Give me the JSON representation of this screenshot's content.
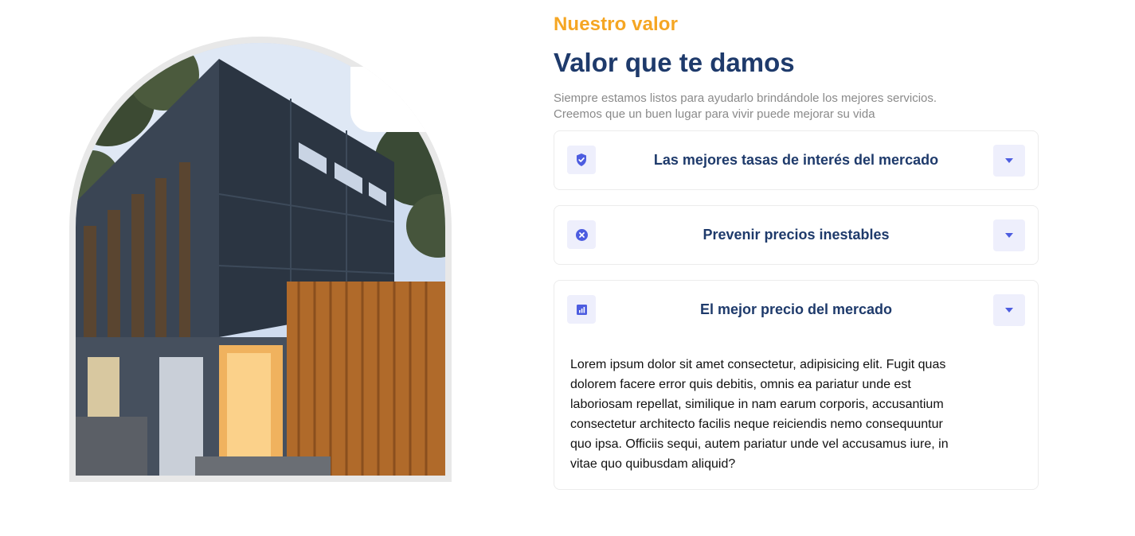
{
  "section": {
    "eyebrow": "Nuestro valor",
    "title": "Valor que te damos",
    "subtitle_lines": [
      "Siempre estamos listos para ayudarlo brindándole los mejores servicios.",
      "Creemos que un buen lugar para vivir puede mejorar su vida"
    ]
  },
  "image": {
    "description_icon": "house-photo"
  },
  "accordion": [
    {
      "icon": "shield-check-icon",
      "title": "Las mejores tasas de interés del mercado",
      "expanded": false
    },
    {
      "icon": "cancel-circle-icon",
      "title": "Prevenir precios inestables",
      "expanded": false
    },
    {
      "icon": "bar-chart-icon",
      "title": "El mejor precio del mercado",
      "expanded": true,
      "body_lines": [
        "Lorem ipsum dolor sit amet consectetur, adipisicing elit. Fugit quas",
        "dolorem facere error quis debitis, omnis ea pariatur unde est",
        "laboriosam repellat, similique in nam earum corporis, accusantium",
        "consectetur architecto facilis neque reiciendis nemo consequuntur",
        "quo ipsa. Officiis sequi, autem pariatur unde vel accusamus iure, in",
        "vitae quo quibusdam aliquid?"
      ]
    }
  ],
  "colors": {
    "accent": "#f5a623",
    "heading": "#1e3a6b",
    "icon": "#4d5de0",
    "icon_bg": "#eeeffc"
  }
}
